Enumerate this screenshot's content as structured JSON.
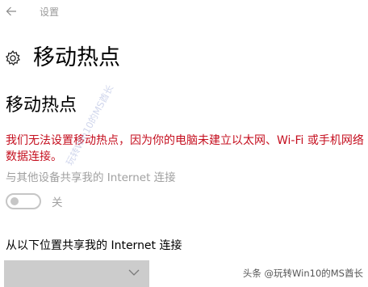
{
  "window": {
    "title": "设置",
    "back_icon": "back-arrow-icon"
  },
  "header": {
    "icon": "gear-icon",
    "title": "移动热点"
  },
  "section": {
    "title": "移动热点"
  },
  "error": {
    "message": "我们无法设置移动热点，因为你的电脑未建立以太网、Wi-Fi 或手机网络数据连接。",
    "color": "#c50f1f"
  },
  "share": {
    "label": "与其他设备共享我的 Internet 连接",
    "toggle_state_label": "关",
    "toggle_on": false
  },
  "source": {
    "label": "从以下位置共享我的 Internet 连接",
    "dropdown_value": "",
    "dropdown_icon": "chevron-down-icon"
  },
  "watermarks": {
    "diagonal": "玩转Win10的MS酋长",
    "corner": "头条 @玩转Win10的MS酋长"
  }
}
